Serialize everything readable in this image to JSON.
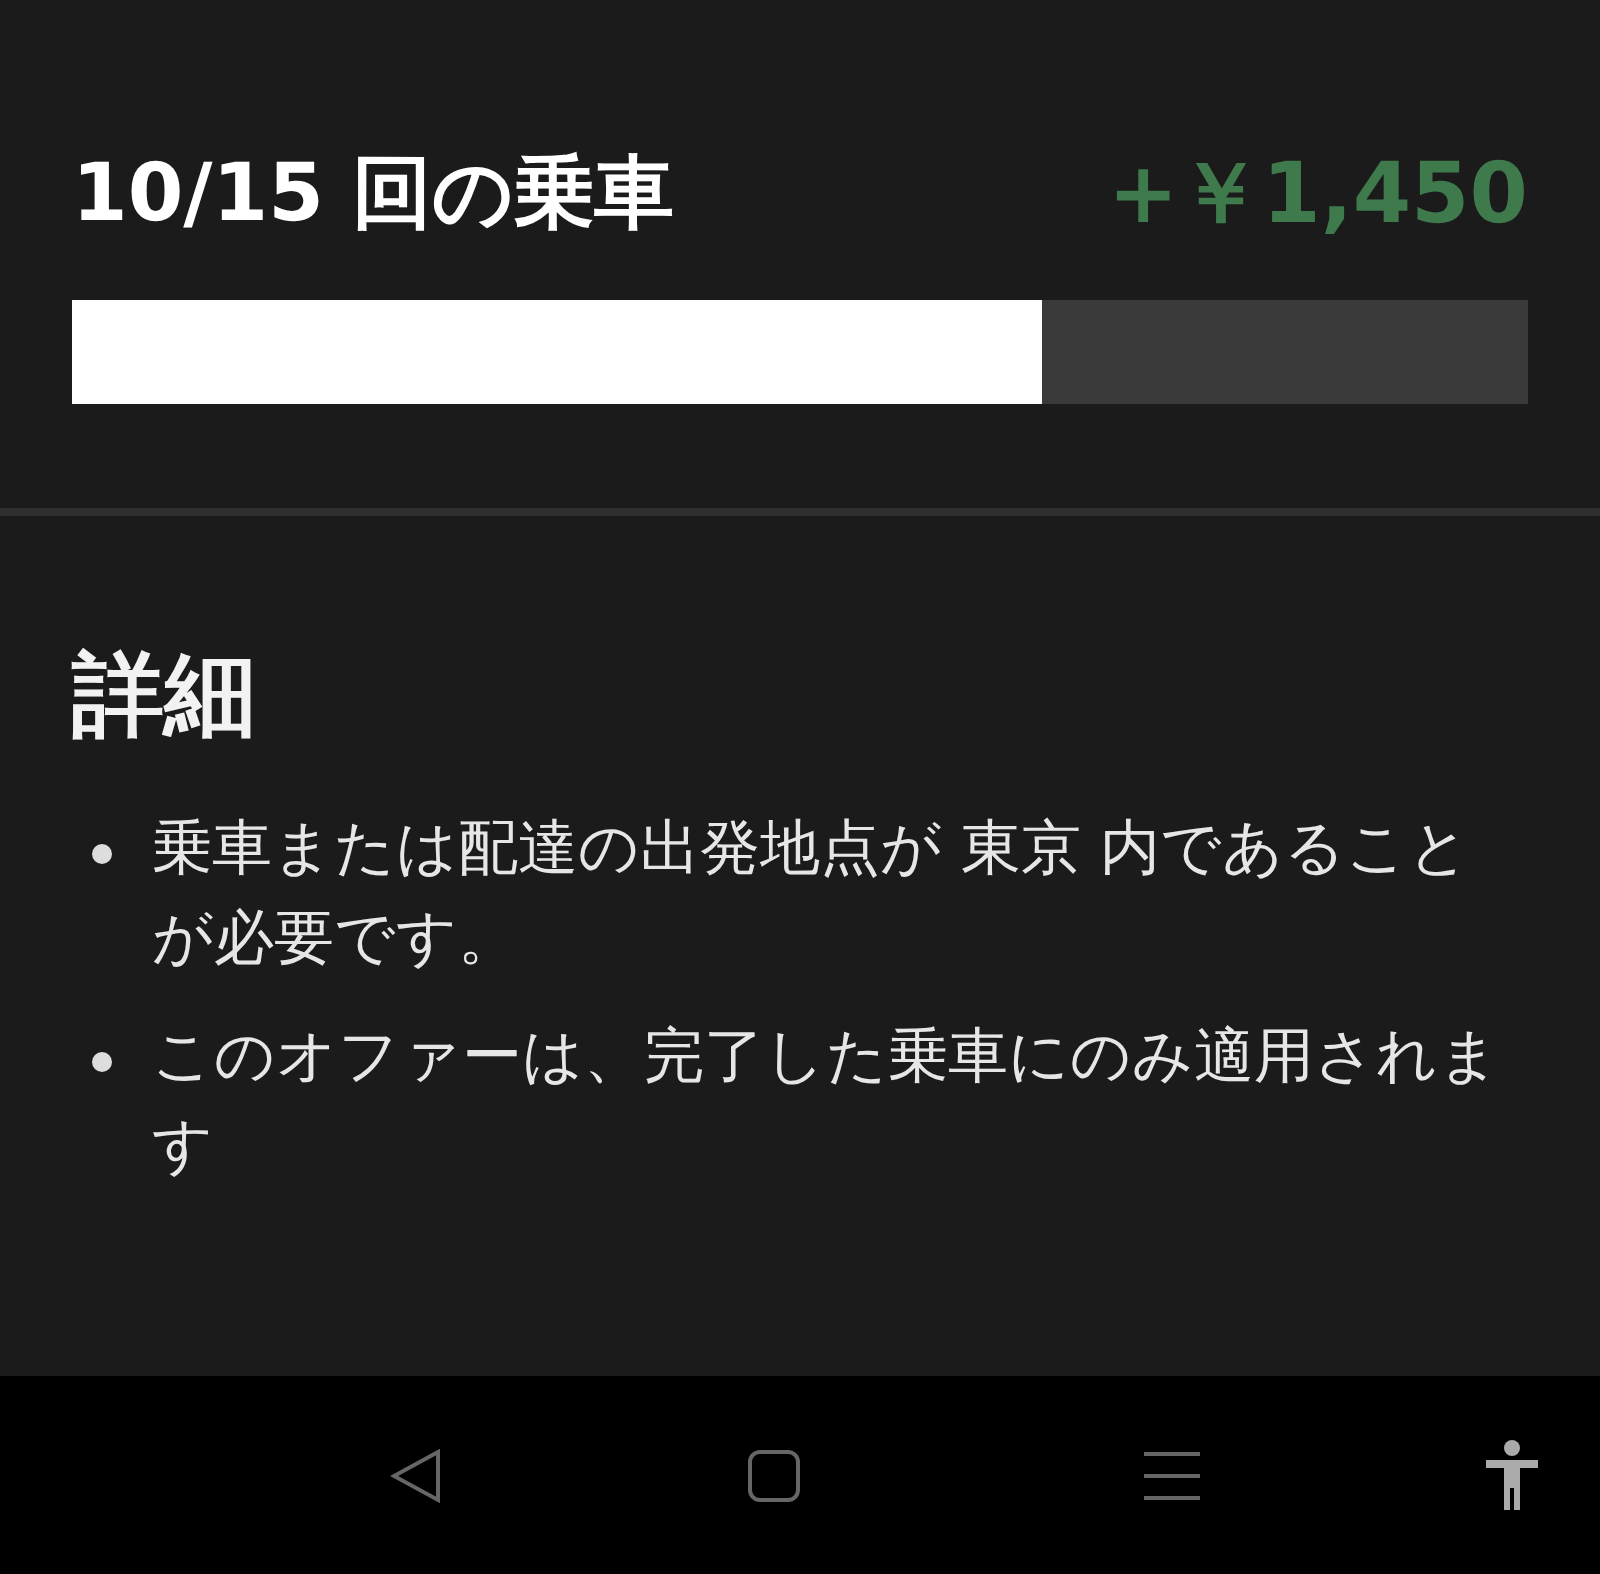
{
  "header": {
    "title": "10/15 回の乗車",
    "amount": "+￥1,450",
    "progress": {
      "level": 0.6667
    }
  },
  "details": {
    "heading": "詳細",
    "items": [
      "乗車または配達の出発地点が 東京 内であることが必要です。",
      "このオファーは、完了した乗車にのみ適用されます"
    ]
  }
}
